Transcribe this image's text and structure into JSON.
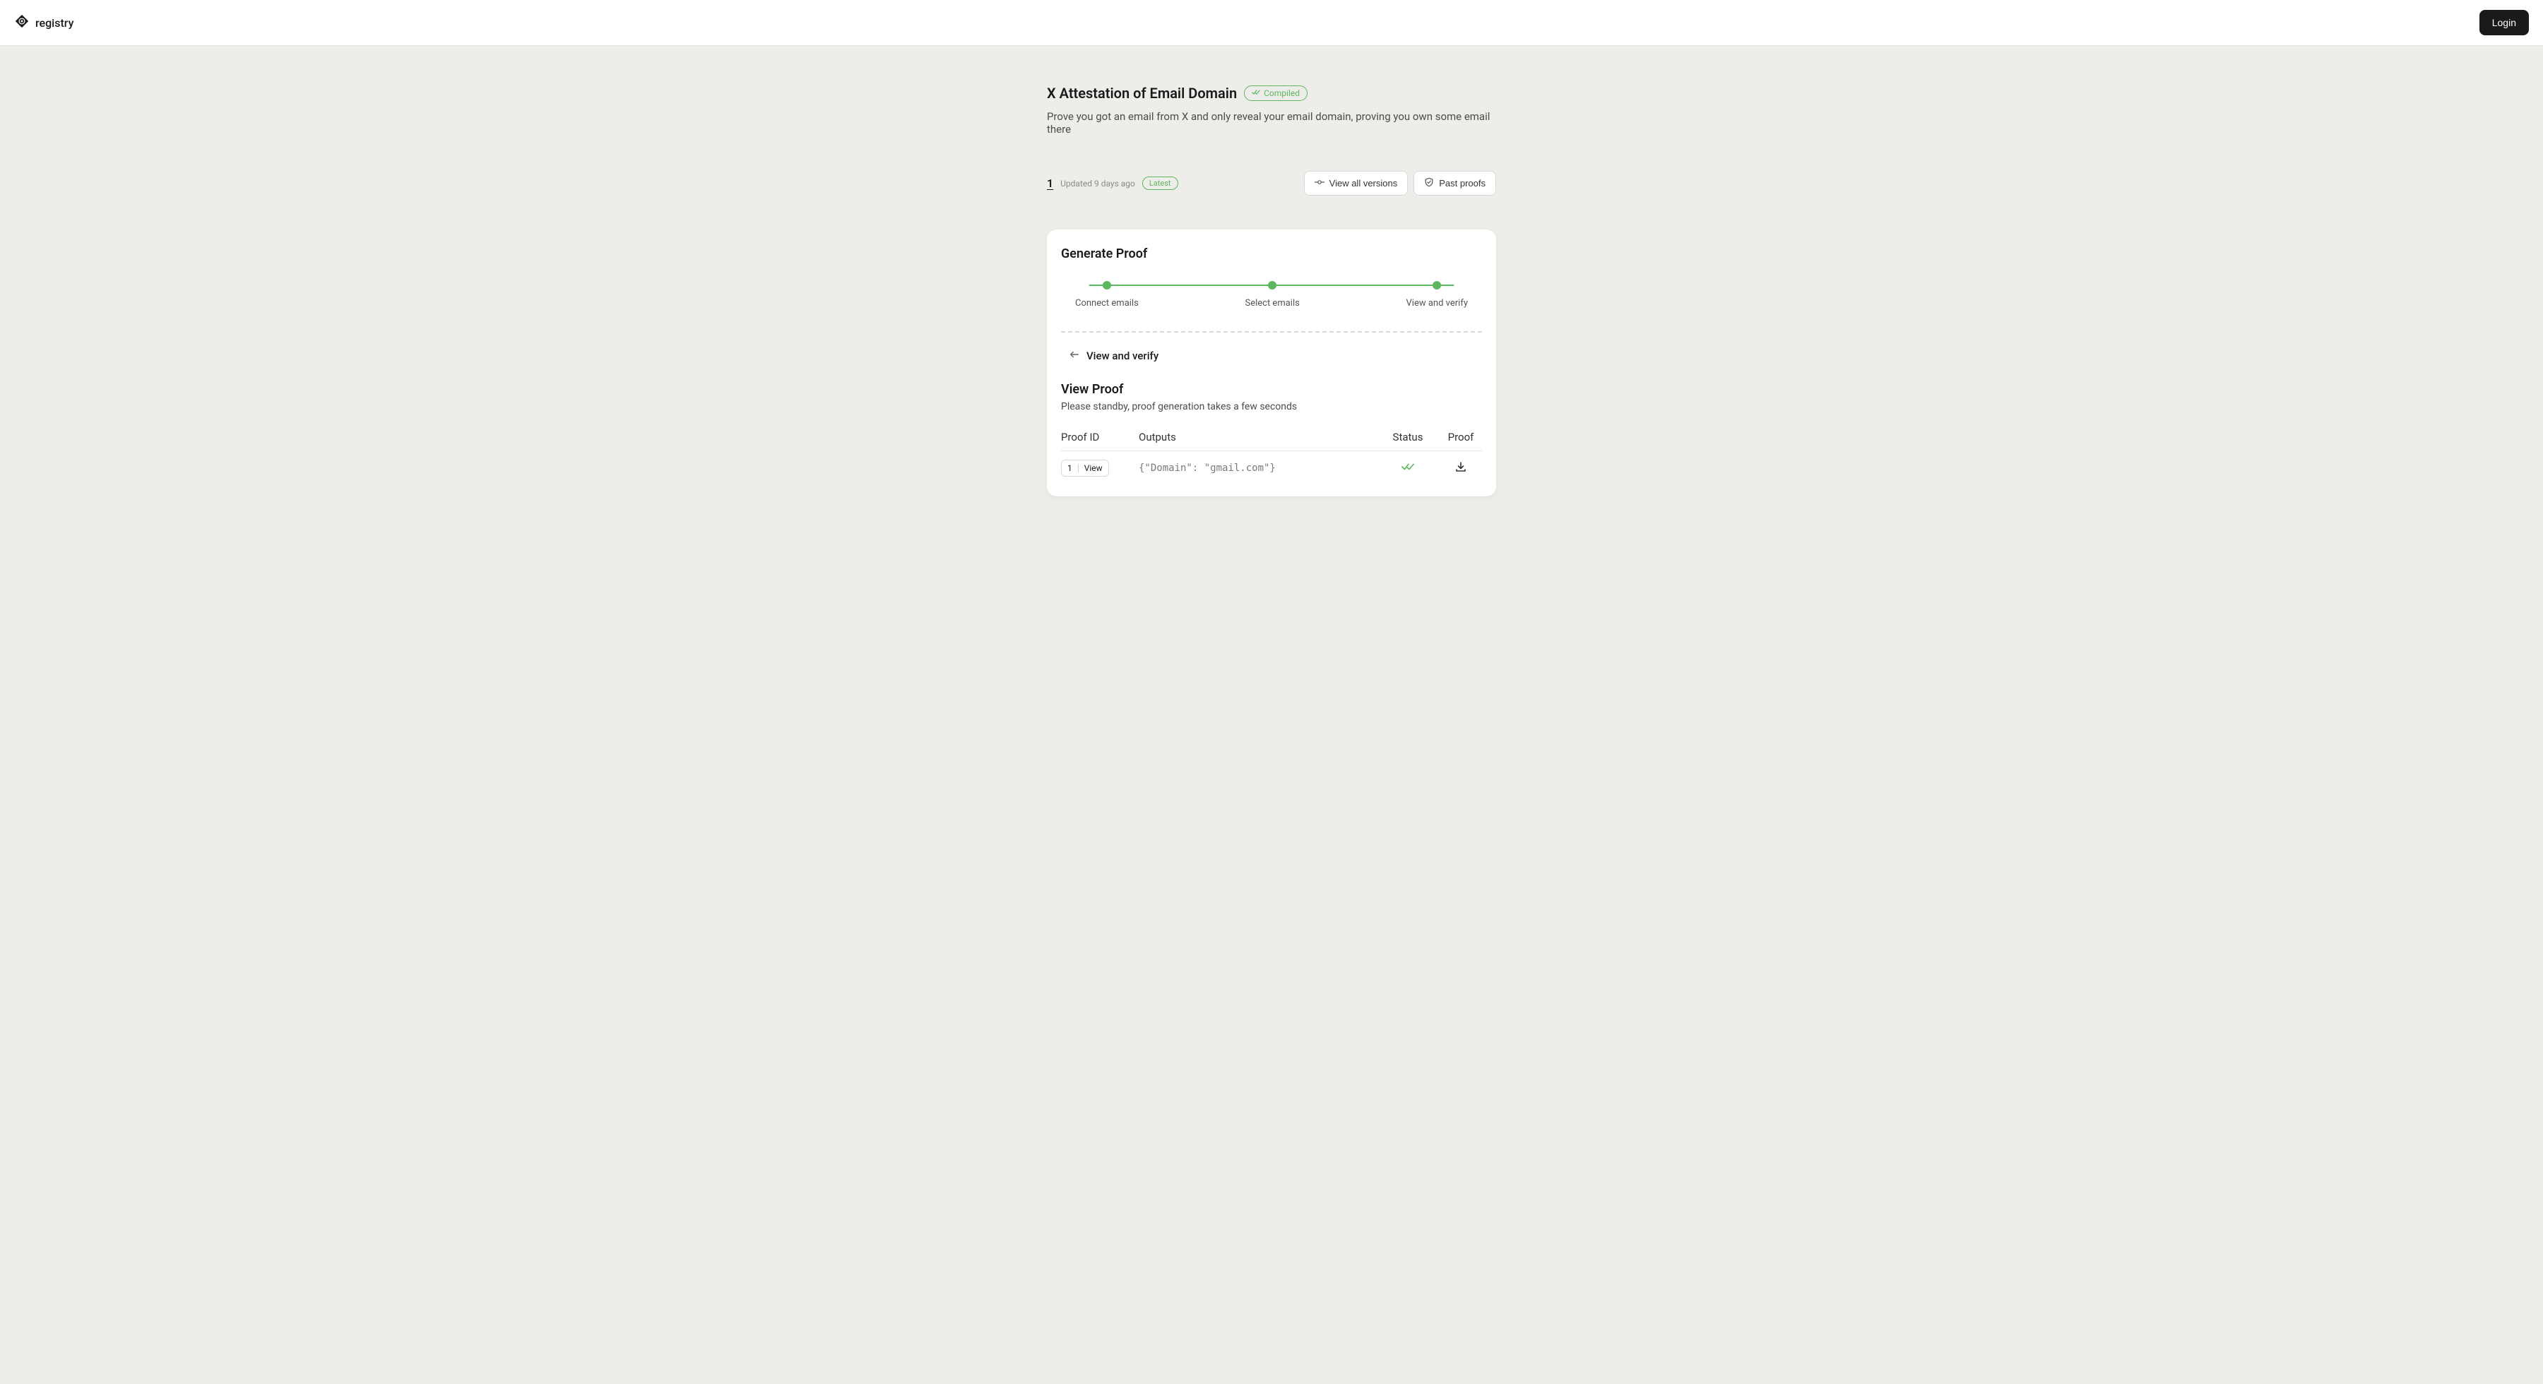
{
  "header": {
    "brand": "registry",
    "login": "Login"
  },
  "page": {
    "title": "X Attestation of Email Domain",
    "compiled_label": "Compiled",
    "subtitle": "Prove you got an email from X and only reveal your email domain, proving you own some email there"
  },
  "meta": {
    "version": "1",
    "updated": "Updated 9 days ago",
    "latest": "Latest",
    "view_all_versions": "View all versions",
    "past_proofs": "Past proofs"
  },
  "generate": {
    "title": "Generate Proof",
    "steps": {
      "connect": "Connect emails",
      "select": "Select emails",
      "verify": "View and verify"
    }
  },
  "back": {
    "label": "View and verify"
  },
  "view_proof": {
    "title": "View Proof",
    "subtitle": "Please standby, proof generation takes a few seconds",
    "columns": {
      "id": "Proof ID",
      "outputs": "Outputs",
      "status": "Status",
      "proof": "Proof"
    },
    "row": {
      "id": "1",
      "view": "View",
      "output": "{\"Domain\": \"gmail.com\"}"
    }
  },
  "colors": {
    "green": "#5cb85c",
    "bg": "#efedea"
  }
}
